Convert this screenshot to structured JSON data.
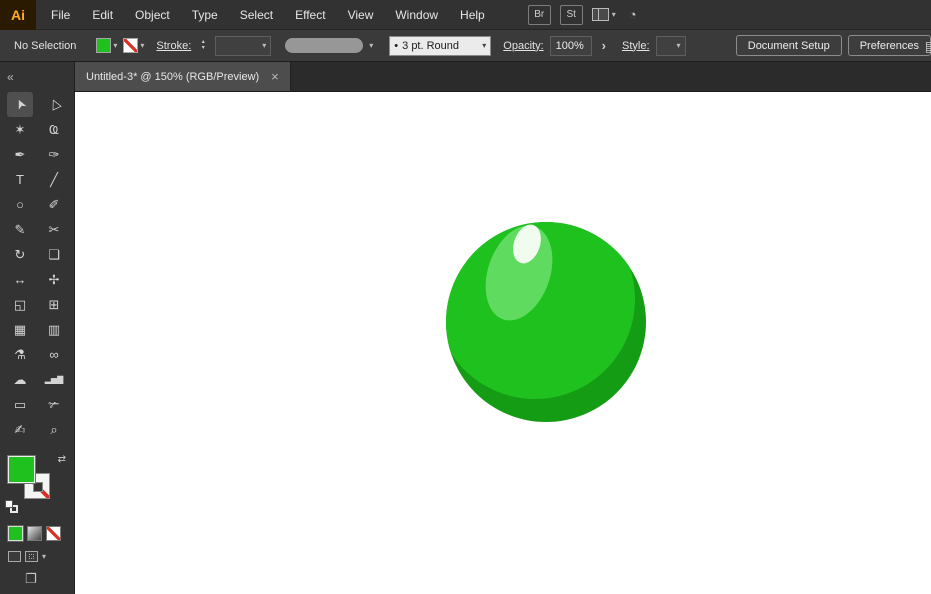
{
  "colors": {
    "green": "#1fc11f",
    "ball": "#1fc11f",
    "ball_shadow": "#159c15",
    "ball_highlight": "#5fdc5f",
    "ball_gloss": "#f0fdee",
    "none_red": "#d93025"
  },
  "menubar": {
    "logo": "Ai",
    "items": [
      "File",
      "Edit",
      "Object",
      "Type",
      "Select",
      "Effect",
      "View",
      "Window",
      "Help"
    ],
    "bridge_button": "Br",
    "stock_button": "St"
  },
  "controlbar": {
    "selection_status": "No Selection",
    "stroke_label": "Stroke:",
    "brush_preset": "3 pt. Round",
    "opacity_label": "Opacity:",
    "opacity_value": "100%",
    "style_label": "Style:",
    "document_setup_button": "Document Setup",
    "preferences_button": "Preferences"
  },
  "tabbar": {
    "tab_title": "Untitled-3* @ 150% (RGB/Preview)",
    "close": "×"
  },
  "toolbar": {
    "collapse_chevron": "«",
    "tools": [
      {
        "name": "selection-tool",
        "glyph": "➤",
        "rotate": -115,
        "selected": true
      },
      {
        "name": "direct-selection-tool",
        "glyph": "▷",
        "rotate": -115
      },
      {
        "name": "magic-wand-tool",
        "glyph": "✶"
      },
      {
        "name": "lasso-tool",
        "glyph": "Ҩ"
      },
      {
        "name": "pen-tool",
        "glyph": "✒"
      },
      {
        "name": "curvature-tool",
        "glyph": "✑"
      },
      {
        "name": "type-tool",
        "glyph": "T"
      },
      {
        "name": "line-segment-tool",
        "glyph": "╱"
      },
      {
        "name": "ellipse-tool",
        "glyph": "○"
      },
      {
        "name": "paintbrush-tool",
        "glyph": "✐"
      },
      {
        "name": "pencil-tool",
        "glyph": "✎"
      },
      {
        "name": "scissors-tool",
        "glyph": "✂"
      },
      {
        "name": "rotate-tool",
        "glyph": "↻"
      },
      {
        "name": "scale-tool",
        "glyph": "❏"
      },
      {
        "name": "width-tool",
        "glyph": "↔"
      },
      {
        "name": "free-transform-tool",
        "glyph": "✢"
      },
      {
        "name": "shape-builder-tool",
        "glyph": "◱"
      },
      {
        "name": "perspective-grid-tool",
        "glyph": "⊞"
      },
      {
        "name": "mesh-tool",
        "glyph": "▦"
      },
      {
        "name": "gradient-tool",
        "glyph": "▥"
      },
      {
        "name": "eyedropper-tool",
        "glyph": "⚗"
      },
      {
        "name": "blend-tool",
        "glyph": "∞"
      },
      {
        "name": "symbol-sprayer-tool",
        "glyph": "☁"
      },
      {
        "name": "column-graph-tool",
        "glyph": "▂▅▇",
        "size": 8
      },
      {
        "name": "artboard-tool",
        "glyph": "▭"
      },
      {
        "name": "slice-tool",
        "glyph": "✃"
      },
      {
        "name": "hand-tool",
        "glyph": "✍"
      },
      {
        "name": "zoom-tool",
        "glyph": "⌕"
      }
    ]
  },
  "icons": {
    "dropdown": "▾",
    "stepper_up": "▴",
    "stepper_down": "▾",
    "chevron_right": "›",
    "swap": "⇄",
    "bullet": "•",
    "gpu_gauge": "◔",
    "panel": "▤",
    "screen_mode": "❐"
  }
}
